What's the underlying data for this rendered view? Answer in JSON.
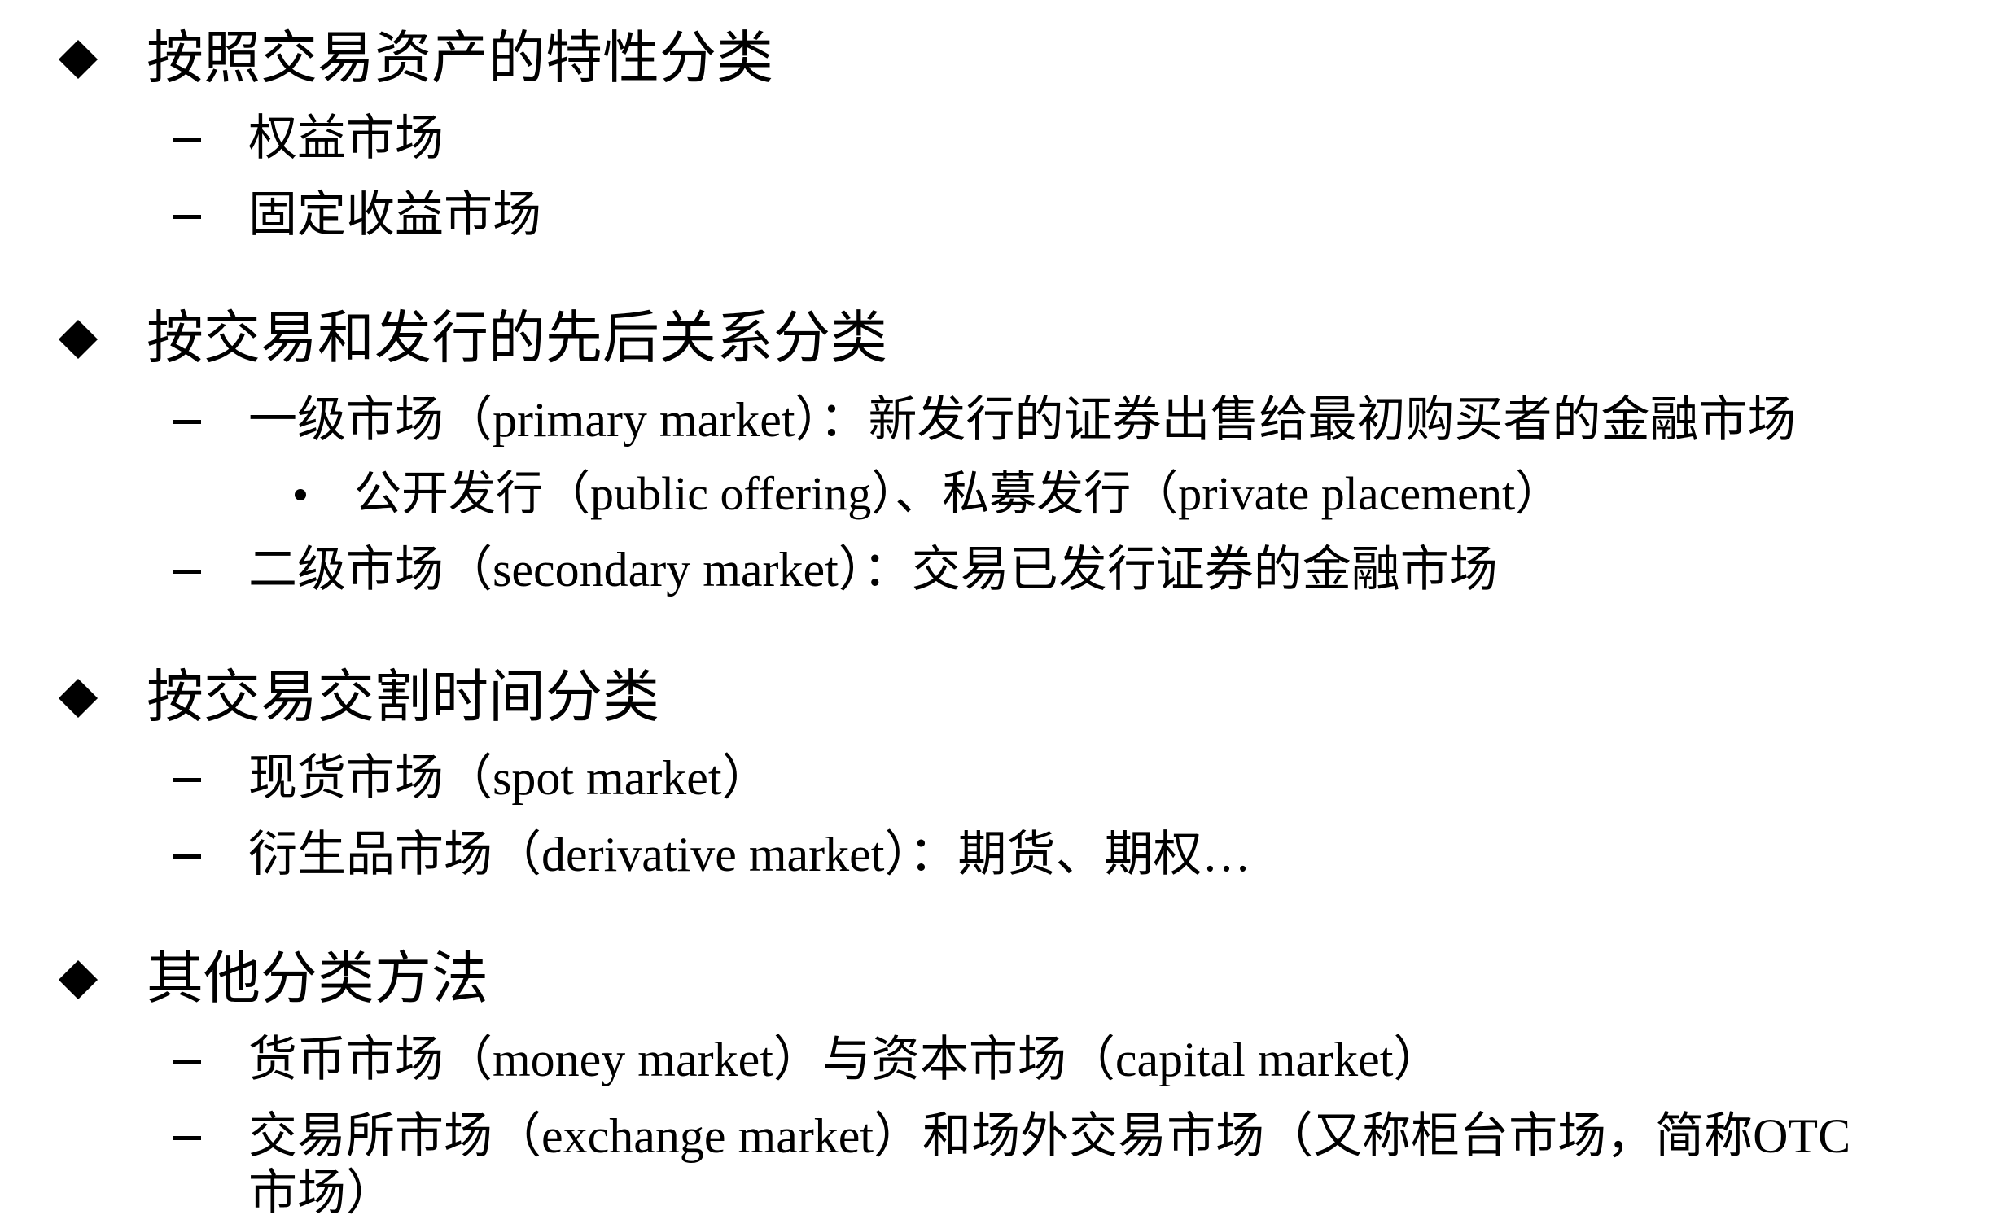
{
  "sections": [
    {
      "heading": "按照交易资产的特性分类",
      "items": [
        "权益市场",
        "固定收益市场"
      ]
    },
    {
      "heading": "按交易和发行的先后关系分类",
      "items": [
        "一级市场（primary market）：新发行的证券出售给最初购买者的金融市场",
        "二级市场（secondary market）：交易已发行证券的金融市场"
      ],
      "subitems": [
        "公开发行（public offering）、私募发行（private placement）"
      ]
    },
    {
      "heading": "按交易交割时间分类",
      "items": [
        "现货市场（spot market）",
        "衍生品市场（derivative market）：期货、期权…"
      ]
    },
    {
      "heading": "其他分类方法",
      "items": [
        "货币市场（money market）与资本市场（capital market）",
        "交易所市场（exchange market）和场外交易市场（又称柜台市场，简称OTC",
        "市场）"
      ]
    }
  ]
}
